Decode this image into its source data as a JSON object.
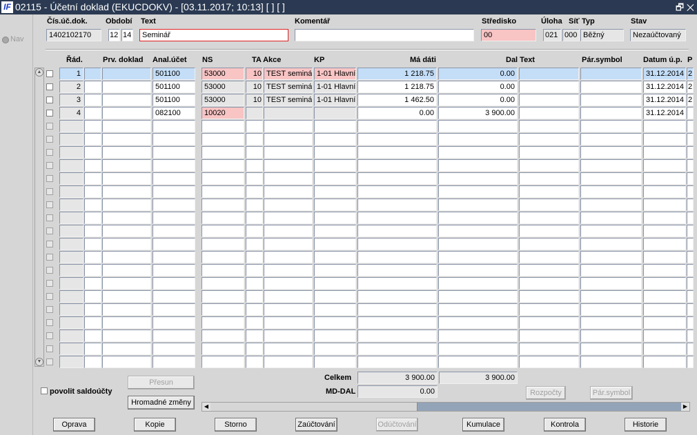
{
  "window": {
    "logo": "IF",
    "title": "02115 - Účetní doklad (EKUCDOKV) - [03.11.2017; 10:13]  [ ]  [ ]",
    "restore_icon": "restore-icon",
    "close_icon": "close-icon"
  },
  "nav": {
    "label": "Nav"
  },
  "header": {
    "labels": {
      "doc": "Čís.úč.dok.",
      "period": "Období",
      "text": "Text",
      "comment": "Komentář",
      "center": "Středisko",
      "task": "Úloha",
      "net": "Síť",
      "type": "Typ",
      "state": "Stav"
    },
    "values": {
      "doc": "1402102170",
      "period_month": "12",
      "period_year": "14",
      "text": "Seminář",
      "comment": "",
      "center": "00",
      "task": "021",
      "net": "000",
      "type": "Běžný",
      "state": "Nezaúčtovaný"
    }
  },
  "grid": {
    "columns": {
      "rad": "Řád.",
      "prv": "Prv. doklad",
      "anal": "Anal.účet",
      "ns": "NS",
      "ta_akce": "TA Akce",
      "kp": "KP",
      "md": "Má dáti",
      "dal_text": "Dal Text",
      "par": "Pár.symbol",
      "datum": "Datum ú.p.",
      "extra": "P"
    },
    "rows": [
      {
        "rad": "1",
        "anal": "501100",
        "ns": "53000",
        "ta": "10",
        "akce": "TEST seminář",
        "kp": "1-01 Hlavní",
        "md": "1 218.75",
        "dal": "0.00",
        "datum": "31.12.2014",
        "extra": "2"
      },
      {
        "rad": "2",
        "anal": "501100",
        "ns": "53000",
        "ta": "10",
        "akce": "TEST seminář",
        "kp": "1-01 Hlavní",
        "md": "1 218.75",
        "dal": "0.00",
        "datum": "31.12.2014",
        "extra": "2"
      },
      {
        "rad": "3",
        "anal": "501100",
        "ns": "53000",
        "ta": "10",
        "akce": "TEST seminář",
        "kp": "1-01 Hlavní",
        "md": "1 462.50",
        "dal": "0.00",
        "datum": "31.12.2014",
        "extra": "2"
      },
      {
        "rad": "4",
        "anal": "082100",
        "ns": "10020",
        "ta": "",
        "akce": "",
        "kp": "",
        "md": "0.00",
        "dal": "3 900.00",
        "datum": "31.12.2014",
        "extra": ""
      }
    ],
    "total_rows": 23
  },
  "totals": {
    "celkem_label": "Celkem",
    "celkem_md": "3 900.00",
    "celkem_dal": "3 900.00",
    "mddal_label": "MD-DAL",
    "mddal": "0.00"
  },
  "controls": {
    "saldo_label": "povolit saldoúčty",
    "presun": "Přesun",
    "hromadne": "Hromadné změny",
    "rozpocty": "Rozpočty",
    "parsymbol": "Pár.symbol"
  },
  "buttons": [
    {
      "label": "Oprava",
      "enabled": true
    },
    {
      "label": "Kopie",
      "enabled": true
    },
    {
      "label": "Storno",
      "enabled": true
    },
    {
      "label": "Zaúčtování",
      "enabled": true
    },
    {
      "label": "Odúčtování",
      "enabled": false
    },
    {
      "label": "Kumulace",
      "enabled": true
    },
    {
      "label": "Kontrola",
      "enabled": true
    },
    {
      "label": "Historie",
      "enabled": true
    }
  ]
}
